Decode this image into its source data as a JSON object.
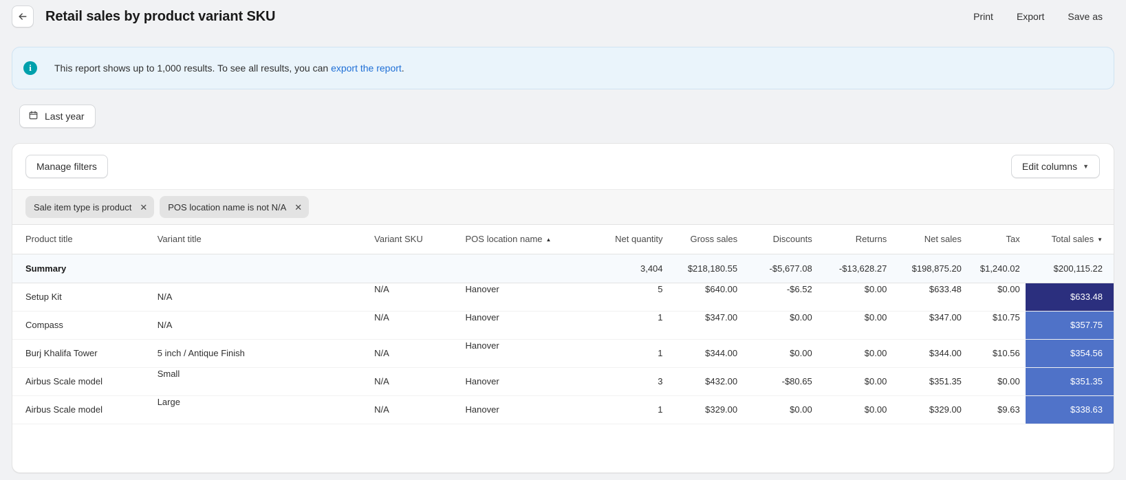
{
  "header": {
    "back_icon": "arrow-left-icon",
    "title": "Retail sales by product variant SKU",
    "actions": [
      {
        "id": "print",
        "label": "Print"
      },
      {
        "id": "export",
        "label": "Export"
      },
      {
        "id": "save-as",
        "label": "Save as"
      }
    ]
  },
  "banner": {
    "icon": "info-icon",
    "icon_glyph": "i",
    "text_before": "This report shows up to 1,000 results. To see all results, you can ",
    "link_text": "export the report",
    "text_after": ".",
    "accent_color": "#00a0ac",
    "background_color": "#eaf4fb",
    "link_color": "#1f6fd6"
  },
  "date_filter": {
    "icon": "calendar-icon",
    "label": "Last year"
  },
  "toolbar": {
    "manage_filters_label": "Manage filters",
    "edit_columns_label": "Edit columns",
    "edit_columns_caret": "▼"
  },
  "filter_chips": [
    {
      "label": "Sale item type is product",
      "remove_icon": "close-icon",
      "remove_glyph": "✕"
    },
    {
      "label": "POS location name is not N/A",
      "remove_icon": "close-icon",
      "remove_glyph": "✕"
    }
  ],
  "table": {
    "columns": [
      {
        "key": "product_title",
        "label": "Product title",
        "align": "left",
        "sort": null
      },
      {
        "key": "variant_title",
        "label": "Variant title",
        "align": "left",
        "sort": null
      },
      {
        "key": "variant_sku",
        "label": "Variant SKU",
        "align": "left",
        "sort": null
      },
      {
        "key": "pos_location_name",
        "label": "POS location name",
        "align": "left",
        "sort": "asc",
        "sort_glyph": "▲"
      },
      {
        "key": "net_quantity",
        "label": "Net quantity",
        "align": "right",
        "sort": null
      },
      {
        "key": "gross_sales",
        "label": "Gross sales",
        "align": "right",
        "sort": null
      },
      {
        "key": "discounts",
        "label": "Discounts",
        "align": "right",
        "sort": null
      },
      {
        "key": "returns",
        "label": "Returns",
        "align": "right",
        "sort": null
      },
      {
        "key": "net_sales",
        "label": "Net sales",
        "align": "right",
        "sort": null
      },
      {
        "key": "tax",
        "label": "Tax",
        "align": "right",
        "sort": null
      },
      {
        "key": "total_sales",
        "label": "Total sales",
        "align": "right",
        "sort": "desc",
        "sort_glyph": "▼"
      }
    ],
    "summary": {
      "label": "Summary",
      "net_quantity": "3,404",
      "gross_sales": "$218,180.55",
      "discounts": "-$5,677.08",
      "returns": "-$13,628.27",
      "net_sales": "$198,875.20",
      "tax": "$1,240.02",
      "total_sales": "$200,115.22"
    },
    "rows": [
      {
        "product_title": "Setup Kit",
        "variant_title": "N/A",
        "variant_sku": "N/A",
        "pos_location_name": "Hanover",
        "net_quantity": "5",
        "gross_sales": "$640.00",
        "discounts": "-$6.52",
        "returns": "$0.00",
        "net_sales": "$633.48",
        "tax": "$0.00",
        "total_sales": "$633.48",
        "total_color": "#2b2f7e"
      },
      {
        "product_title": "Compass",
        "variant_title": "N/A",
        "variant_sku": "N/A",
        "pos_location_name": "Hanover",
        "net_quantity": "1",
        "gross_sales": "$347.00",
        "discounts": "$0.00",
        "returns": "$0.00",
        "net_sales": "$347.00",
        "tax": "$10.75",
        "total_sales": "$357.75",
        "total_color": "#4f72c8"
      },
      {
        "product_title": "Burj Khalifa Tower",
        "variant_title": "5 inch / Antique Finish",
        "variant_sku": "N/A",
        "pos_location_name": "Hanover",
        "net_quantity": "1",
        "gross_sales": "$344.00",
        "discounts": "$0.00",
        "returns": "$0.00",
        "net_sales": "$344.00",
        "tax": "$10.56",
        "total_sales": "$354.56",
        "total_color": "#4f72c8"
      },
      {
        "product_title": "Airbus Scale model",
        "variant_title": "Small",
        "variant_sku": "N/A",
        "pos_location_name": "Hanover",
        "net_quantity": "3",
        "gross_sales": "$432.00",
        "discounts": "-$80.65",
        "returns": "$0.00",
        "net_sales": "$351.35",
        "tax": "$0.00",
        "total_sales": "$351.35",
        "total_color": "#4f72c8"
      },
      {
        "product_title": "Airbus Scale model",
        "variant_title": "Large",
        "variant_sku": "N/A",
        "pos_location_name": "Hanover",
        "net_quantity": "1",
        "gross_sales": "$329.00",
        "discounts": "$0.00",
        "returns": "$0.00",
        "net_sales": "$329.00",
        "tax": "$9.63",
        "total_sales": "$338.63",
        "total_color": "#5073c9"
      }
    ]
  }
}
